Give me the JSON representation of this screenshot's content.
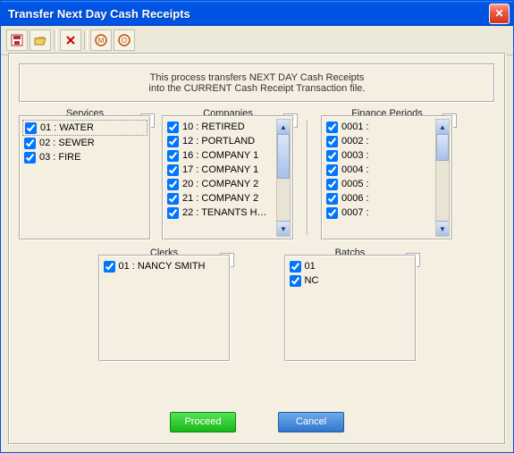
{
  "window": {
    "title": "Transfer Next Day Cash Receipts"
  },
  "banner": {
    "line1": "This process transfers NEXT DAY Cash Receipts",
    "line2": "into the CURRENT Cash Receipt Transaction file."
  },
  "panels": {
    "services": {
      "title": "Services",
      "items": [
        "01 : WATER",
        "02 : SEWER",
        "03 : FIRE"
      ]
    },
    "companies": {
      "title": "Companies",
      "items": [
        "10 : RETIRED",
        "12 : PORTLAND",
        "16 : COMPANY 1",
        "17 : COMPANY 1",
        "20 : COMPANY 2",
        "21 : COMPANY 2",
        "22 : TENANTS H…"
      ]
    },
    "finance_periods": {
      "title": "Finance Periods",
      "items": [
        "0001 :",
        "0002 :",
        "0003 :",
        "0004 :",
        "0005 :",
        "0006 :",
        "0007 :"
      ]
    },
    "clerks": {
      "title": "Clerks",
      "items": [
        "01   : NANCY SMITH"
      ]
    },
    "batches": {
      "title": "Batchs",
      "items": [
        "01",
        "NC"
      ]
    }
  },
  "buttons": {
    "proceed": "Proceed",
    "cancel": "Cancel"
  }
}
